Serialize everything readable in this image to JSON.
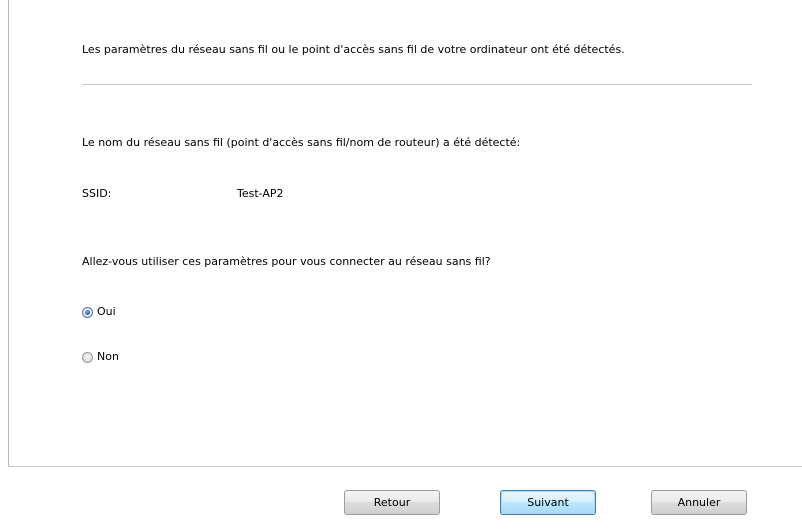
{
  "main": {
    "detected_message": "Les paramètres du réseau sans fil ou le point d'accès sans fil de votre ordinateur ont été détectés.",
    "network_name_message": "Le nom du réseau sans fil (point d'accès sans fil/nom de routeur) a été détecté:",
    "ssid_label": "SSID:",
    "ssid_value": "Test-AP2",
    "question": "Allez-vous utiliser ces paramètres pour vous connecter au réseau sans fil?",
    "options": [
      {
        "label": "Oui",
        "selected": true
      },
      {
        "label": "Non",
        "selected": false
      }
    ]
  },
  "footer": {
    "back_label": "Retour",
    "next_label": "Suivant",
    "cancel_label": "Annuler"
  },
  "colors": {
    "default_button_border": "#3c7fb1",
    "radio_selected": "#2a65b8"
  }
}
